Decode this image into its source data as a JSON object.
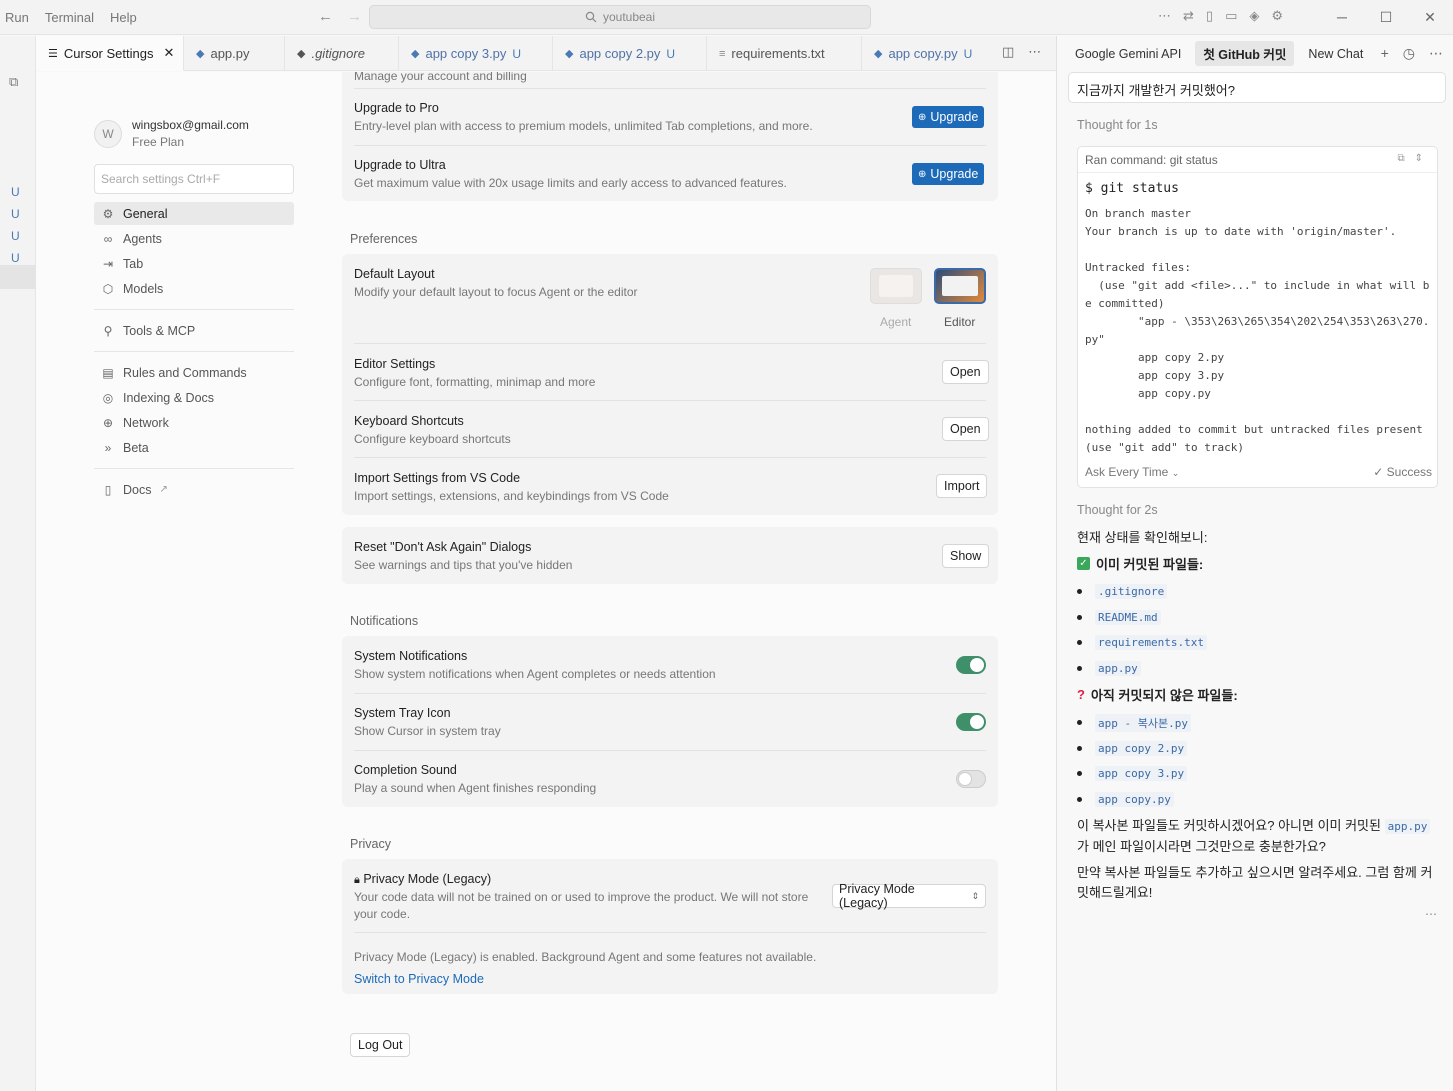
{
  "titlebar": {
    "menu": [
      "Run",
      "Terminal",
      "Help"
    ],
    "search_value": "youtubeai"
  },
  "activity": {
    "git_markers": [
      "U",
      "U",
      "U",
      "U"
    ]
  },
  "tabs": [
    {
      "label": "Cursor Settings",
      "icon": "gear-icon",
      "closable": true,
      "u": ""
    },
    {
      "label": "app.py",
      "icon": "python-icon",
      "u": ""
    },
    {
      "label": ".gitignore",
      "icon": "git-icon",
      "u": ""
    },
    {
      "label": "app copy 3.py",
      "icon": "python-icon",
      "u": "U"
    },
    {
      "label": "app copy 2.py",
      "icon": "python-icon",
      "u": "U"
    },
    {
      "label": "requirements.txt",
      "icon": "text-file-icon",
      "u": ""
    },
    {
      "label": "app copy.py",
      "icon": "python-icon",
      "u": "U"
    }
  ],
  "settings": {
    "profile": {
      "avatar": "W",
      "email": "wingsbox@gmail.com",
      "plan": "Free Plan"
    },
    "search_placeholder": "Search settings Ctrl+F",
    "nav": {
      "general": "General",
      "agents": "Agents",
      "tab": "Tab",
      "models": "Models",
      "tools": "Tools & MCP",
      "rules": "Rules and Commands",
      "indexing": "Indexing & Docs",
      "network": "Network",
      "beta": "Beta",
      "docs": "Docs"
    },
    "account": {
      "manage_desc": "Manage your account and billing",
      "pro_title": "Upgrade to Pro",
      "pro_desc": "Entry-level plan with access to premium models, unlimited Tab completions, and more.",
      "ultra_title": "Upgrade to Ultra",
      "ultra_desc": "Get maximum value with 20x usage limits and early access to advanced features.",
      "upgrade_label": "Upgrade"
    },
    "preferences": {
      "label": "Preferences",
      "layout_title": "Default Layout",
      "layout_desc": "Modify your default layout to focus Agent or the editor",
      "agent_label": "Agent",
      "editor_label": "Editor",
      "editor_title": "Editor Settings",
      "editor_desc": "Configure font, formatting, minimap and more",
      "keys_title": "Keyboard Shortcuts",
      "keys_desc": "Configure keyboard shortcuts",
      "open_label": "Open",
      "import_title": "Import Settings from VS Code",
      "import_desc": "Import settings, extensions, and keybindings from VS Code",
      "import_label": "Import",
      "reset_title": "Reset \"Don't Ask Again\" Dialogs",
      "reset_desc": "See warnings and tips that you've hidden",
      "show_label": "Show"
    },
    "notifications": {
      "label": "Notifications",
      "sys_title": "System Notifications",
      "sys_desc": "Show system notifications when Agent completes or needs attention",
      "sys_on": true,
      "tray_title": "System Tray Icon",
      "tray_desc": "Show Cursor in system tray",
      "tray_on": true,
      "sound_title": "Completion Sound",
      "sound_desc": "Play a sound when Agent finishes responding",
      "sound_on": false
    },
    "privacy": {
      "label": "Privacy",
      "title": "Privacy Mode (Legacy)",
      "desc": "Your code data will not be trained on or used to improve the product. We will not store your code.",
      "select_value": "Privacy Mode (Legacy)",
      "note": "Privacy Mode (Legacy) is enabled. Background Agent and some features not available.",
      "switch_link": "Switch to Privacy Mode"
    },
    "logout_label": "Log Out"
  },
  "chat": {
    "tabs": [
      "Google Gemini API",
      "첫 GitHub 커밋",
      "New Chat"
    ],
    "active_tab": 1,
    "user_message": "지금까지 개발한거 커밋했어?",
    "thought1": "Thought for 1s",
    "command_header": "Ran command: git status",
    "command": "$ git status",
    "output": "On branch master\nYour branch is up to date with 'origin/master'.\n\nUntracked files:\n  (use \"git add <file>...\" to include in what will b\ne committed)\n        \"app - \\353\\263\\265\\354\\202\\254\\353\\263\\270.\npy\"\n        app copy 2.py\n        app copy 3.py\n        app copy.py\n\nnothing added to commit but untracked files present\n(use \"git add\" to track)",
    "ask_mode": "Ask Every Time",
    "status": "Success",
    "thought2": "Thought for 2s",
    "intro": "현재 상태를 확인해보니:",
    "committed_heading": "이미 커밋된 파일들:",
    "committed": [
      ".gitignore",
      "README.md",
      "requirements.txt",
      "app.py"
    ],
    "uncommitted_heading": "아직 커밋되지 않은 파일들:",
    "uncommitted": [
      "app - 복사본.py",
      "app copy 2.py",
      "app copy 3.py",
      "app copy.py"
    ],
    "question_a": "이 복사본 파일들도 커밋하시겠어요? 아니면 이미 커밋된",
    "question_code": "app.py",
    "question_b": "가 메인 파일이시라면 그것만으로 충분한가요?",
    "closing": "만약 복사본 파일들도 추가하고 싶으시면 알려주세요. 그럼 함께 커밋해드릴게요!"
  }
}
